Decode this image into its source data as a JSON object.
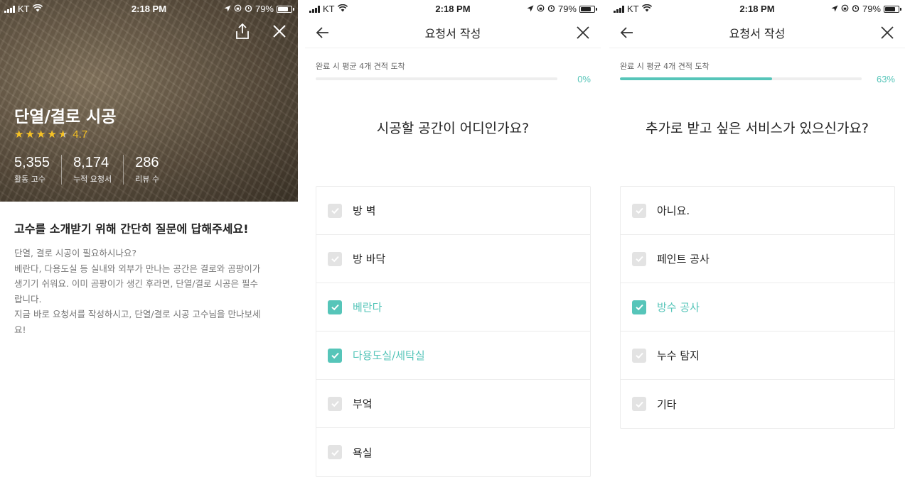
{
  "status_bar": {
    "carrier": "KT",
    "time": "2:18 PM",
    "battery": "79%",
    "battery_level": 0.79
  },
  "intro": {
    "title": "단열/결로 시공",
    "rating": 4.7,
    "rating_text": "4.7",
    "stats": [
      {
        "value": "5,355",
        "label": "활동 고수"
      },
      {
        "value": "8,174",
        "label": "누적 요청서"
      },
      {
        "value": "286",
        "label": "리뷰 수"
      }
    ],
    "heading": "고수를 소개받기 위해 간단히 질문에 답해주세요!",
    "description_lines": [
      "단열, 결로 시공이 필요하시나요?",
      "베란다, 다용도실 등 실내와 외부가 만나는 공간은 결로와 곰팡이가",
      "생기기 쉬워요. 이미 곰팡이가 생긴 후라면, 단열/결로 시공은 필수",
      "랍니다.",
      "지금 바로 요청서를 작성하시고, 단열/결로 시공 고수님을 만나보세",
      "요!"
    ],
    "icons": {
      "share": "share-icon",
      "close": "close-icon"
    }
  },
  "form_step_1": {
    "nav_title": "요청서 작성",
    "progress_label": "완료 시 평균 4개 견적 도착",
    "progress_text": "0%",
    "progress": 0,
    "question": "시공할 공간이 어디인가요?",
    "options": [
      {
        "label": "방 벽",
        "checked": false
      },
      {
        "label": "방 바닥",
        "checked": false
      },
      {
        "label": "베란다",
        "checked": true
      },
      {
        "label": "다용도실/세탁실",
        "checked": true
      },
      {
        "label": "부엌",
        "checked": false
      },
      {
        "label": "욕실",
        "checked": false
      }
    ]
  },
  "form_step_2": {
    "nav_title": "요청서 작성",
    "progress_label": "완료 시 평균 4개 견적 도착",
    "progress_text": "63%",
    "progress": 0.63,
    "question": "추가로 받고 싶은 서비스가 있으신가요?",
    "options": [
      {
        "label": "아니요.",
        "checked": false
      },
      {
        "label": "페인트 공사",
        "checked": false
      },
      {
        "label": "방수 공사",
        "checked": true
      },
      {
        "label": "누수 탐지",
        "checked": false
      },
      {
        "label": "기타",
        "checked": false
      }
    ]
  },
  "colors": {
    "accent": "#56c5b9",
    "star": "#f7c325",
    "unchecked_box": "#e3e3e3"
  }
}
